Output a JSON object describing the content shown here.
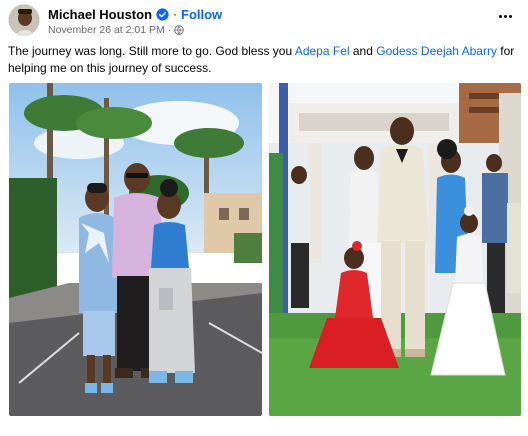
{
  "post": {
    "author": "Michael Houston",
    "follow_label": "Follow",
    "timestamp": "November 26 at 2:01 PM",
    "text_before": "The journey was long. Still more to go. God bless you ",
    "mention_1": "Adepa Fel",
    "text_between": " and ",
    "mention_2": "Godess Deejah Abarry",
    "text_after": " for helping me on this journey of success."
  },
  "icons": {
    "verified": "verified-badge-icon",
    "audience": "globe-icon",
    "more": "more-options-icon"
  },
  "colors": {
    "link": "#0866ff",
    "verified": "#0866ff",
    "meta": "#65676b",
    "text": "#050505"
  }
}
